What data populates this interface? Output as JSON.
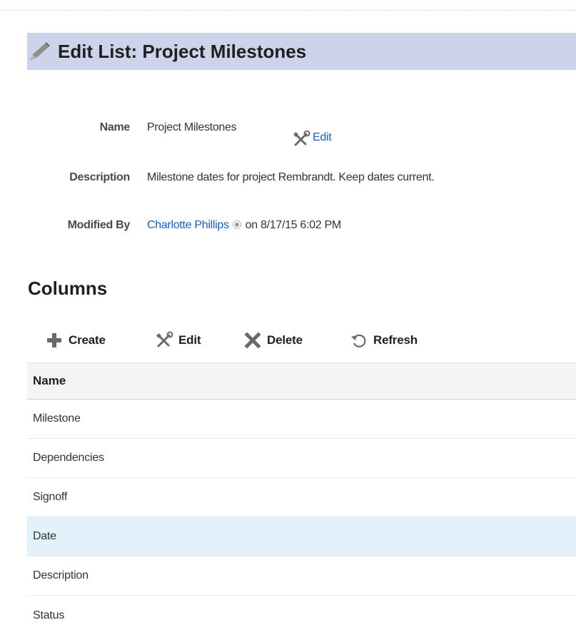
{
  "page": {
    "title": "Edit List: Project Milestones",
    "title_icon": "pencil-icon"
  },
  "properties": {
    "name_label": "Name",
    "name_value": "Project Milestones",
    "name_edit_icon": "tools-icon",
    "name_edit_link": "Edit",
    "description_label": "Description",
    "description_value": "Milestone dates for project Rembrandt. Keep dates current.",
    "modified_by_label": "Modified By",
    "modified_by_user": "Charlotte Phillips",
    "modified_by_presence_icon": "presence-icon",
    "modified_by_date": "on 8/17/15 6:02 PM"
  },
  "columns_section": {
    "heading": "Columns",
    "toolbar": {
      "create_label": "Create",
      "create_icon": "plus-icon",
      "edit_label": "Edit",
      "edit_icon": "tools-icon",
      "delete_label": "Delete",
      "delete_icon": "x-icon",
      "refresh_label": "Refresh",
      "refresh_icon": "refresh-icon"
    },
    "table": {
      "header": "Name",
      "rows": [
        {
          "name": "Milestone",
          "selected": false
        },
        {
          "name": "Dependencies",
          "selected": false
        },
        {
          "name": "Signoff",
          "selected": false
        },
        {
          "name": "Date",
          "selected": true
        },
        {
          "name": "Description",
          "selected": false
        },
        {
          "name": "Status",
          "selected": false
        }
      ]
    }
  },
  "colors": {
    "title_bar_bg": "#ccd3ea",
    "link": "#1a5fb0",
    "selected_row_bg": "#e3f1fb",
    "header_bg": "#f3f4f3"
  }
}
